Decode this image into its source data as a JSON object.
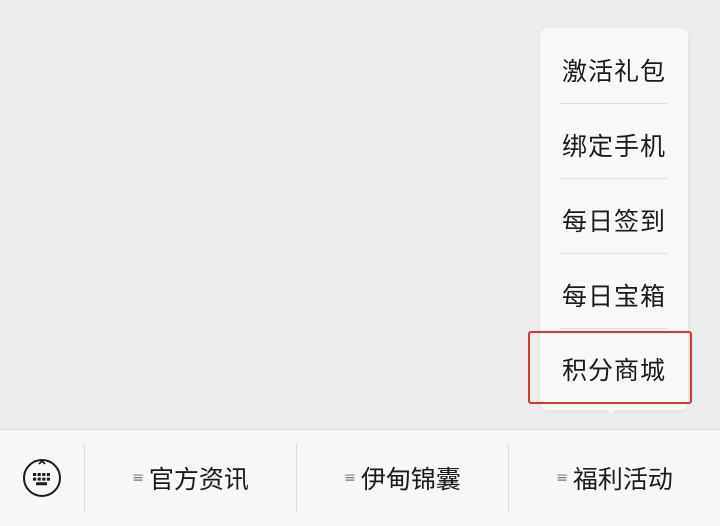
{
  "popup_menu": {
    "items": [
      {
        "label": "激活礼包"
      },
      {
        "label": "绑定手机"
      },
      {
        "label": "每日签到"
      },
      {
        "label": "每日宝箱"
      },
      {
        "label": "积分商城"
      }
    ],
    "highlighted_item": "积分商城",
    "highlight_color": "#e0342c"
  },
  "bottom_bar": {
    "keyboard_icon": "keyboard-icon",
    "menus": [
      {
        "label": "官方资讯",
        "icon": "menu-lines-icon"
      },
      {
        "label": "伊甸锦囊",
        "icon": "menu-lines-icon"
      },
      {
        "label": "福利活动",
        "icon": "menu-lines-icon"
      }
    ]
  }
}
